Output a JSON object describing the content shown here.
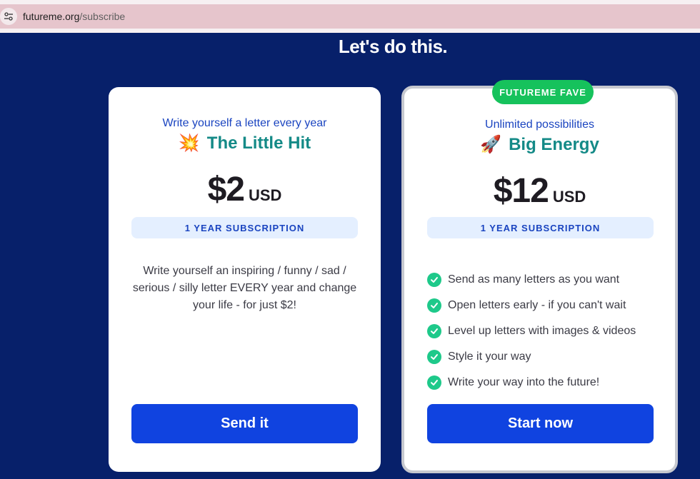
{
  "browser": {
    "url_domain": "futureme.org",
    "url_path": "/subscribe"
  },
  "page": {
    "headline": "Let's do this."
  },
  "plans": [
    {
      "tagline": "Write yourself a letter every year",
      "emoji": "💥",
      "name": "The Little Hit",
      "price": "$2",
      "currency": "USD",
      "term": "1 YEAR SUBSCRIPTION",
      "description": "Write yourself an inspiring / funny / sad / serious / silly letter EVERY year and change your life - for just $2!",
      "cta": "Send it"
    },
    {
      "badge": "FUTUREME FAVE",
      "tagline": "Unlimited possibilities",
      "emoji": "🚀",
      "name": "Big Energy",
      "price": "$12",
      "currency": "USD",
      "term": "1 YEAR SUBSCRIPTION",
      "features": [
        "Send as many letters as you want",
        "Open letters early - if you can't wait",
        "Level up letters with images & videos",
        "Style it your way",
        "Write your way into the future!"
      ],
      "cta": "Start now"
    }
  ],
  "colors": {
    "background": "#07206a",
    "accent": "#1043e0",
    "teal": "#148a87",
    "badge": "#16c25c",
    "check": "#1ec98a"
  }
}
